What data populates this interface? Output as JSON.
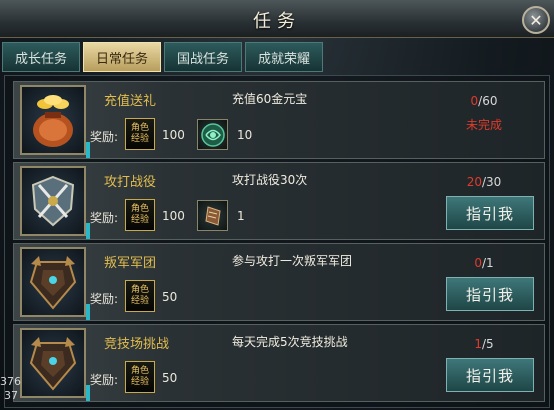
{
  "window": {
    "title": "任务",
    "close_icon": "close-icon"
  },
  "tabs": [
    {
      "label": "成长任务",
      "active": false
    },
    {
      "label": "日常任务",
      "active": true
    },
    {
      "label": "国战任务",
      "active": false
    },
    {
      "label": "成就荣耀",
      "active": false
    }
  ],
  "reward_label": "奖励:",
  "xp_badge": {
    "line1": "角色",
    "line2": "经验"
  },
  "tasks": [
    {
      "name": "充值送礼",
      "desc": "充值60金元宝",
      "xp": "100",
      "item_icon": "jade-token-icon",
      "item_amount": "10",
      "progress_current": "0",
      "progress_total": "/60",
      "status": "未完成",
      "button": "",
      "portrait_icon": "gold-sack-icon"
    },
    {
      "name": "攻打战役",
      "desc": "攻打战役30次",
      "xp": "100",
      "item_icon": "scroll-item-icon",
      "item_amount": "1",
      "progress_current": "20",
      "progress_total": "/30",
      "status": "",
      "button": "指引我",
      "portrait_icon": "crossed-swords-shield-icon"
    },
    {
      "name": "叛军军团",
      "desc": "参与攻打一次叛军军团",
      "xp": "50",
      "item_icon": "",
      "item_amount": "",
      "progress_current": "0",
      "progress_total": "/1",
      "status": "",
      "button": "指引我",
      "portrait_icon": "armored-warrior-icon"
    },
    {
      "name": "竞技场挑战",
      "desc": "每天完成5次竞技挑战",
      "xp": "50",
      "item_icon": "",
      "item_amount": "",
      "progress_current": "1",
      "progress_total": "/5",
      "status": "",
      "button": "指引我",
      "portrait_icon": "armored-warrior-icon"
    }
  ],
  "corner_overlay": {
    "line1": "376",
    "line2": "37"
  },
  "colors": {
    "accent_gold": "#e2bd4f",
    "progress_red": "#e23a2a",
    "button_teal": "#2f6667",
    "active_tab": "#d9c487"
  }
}
